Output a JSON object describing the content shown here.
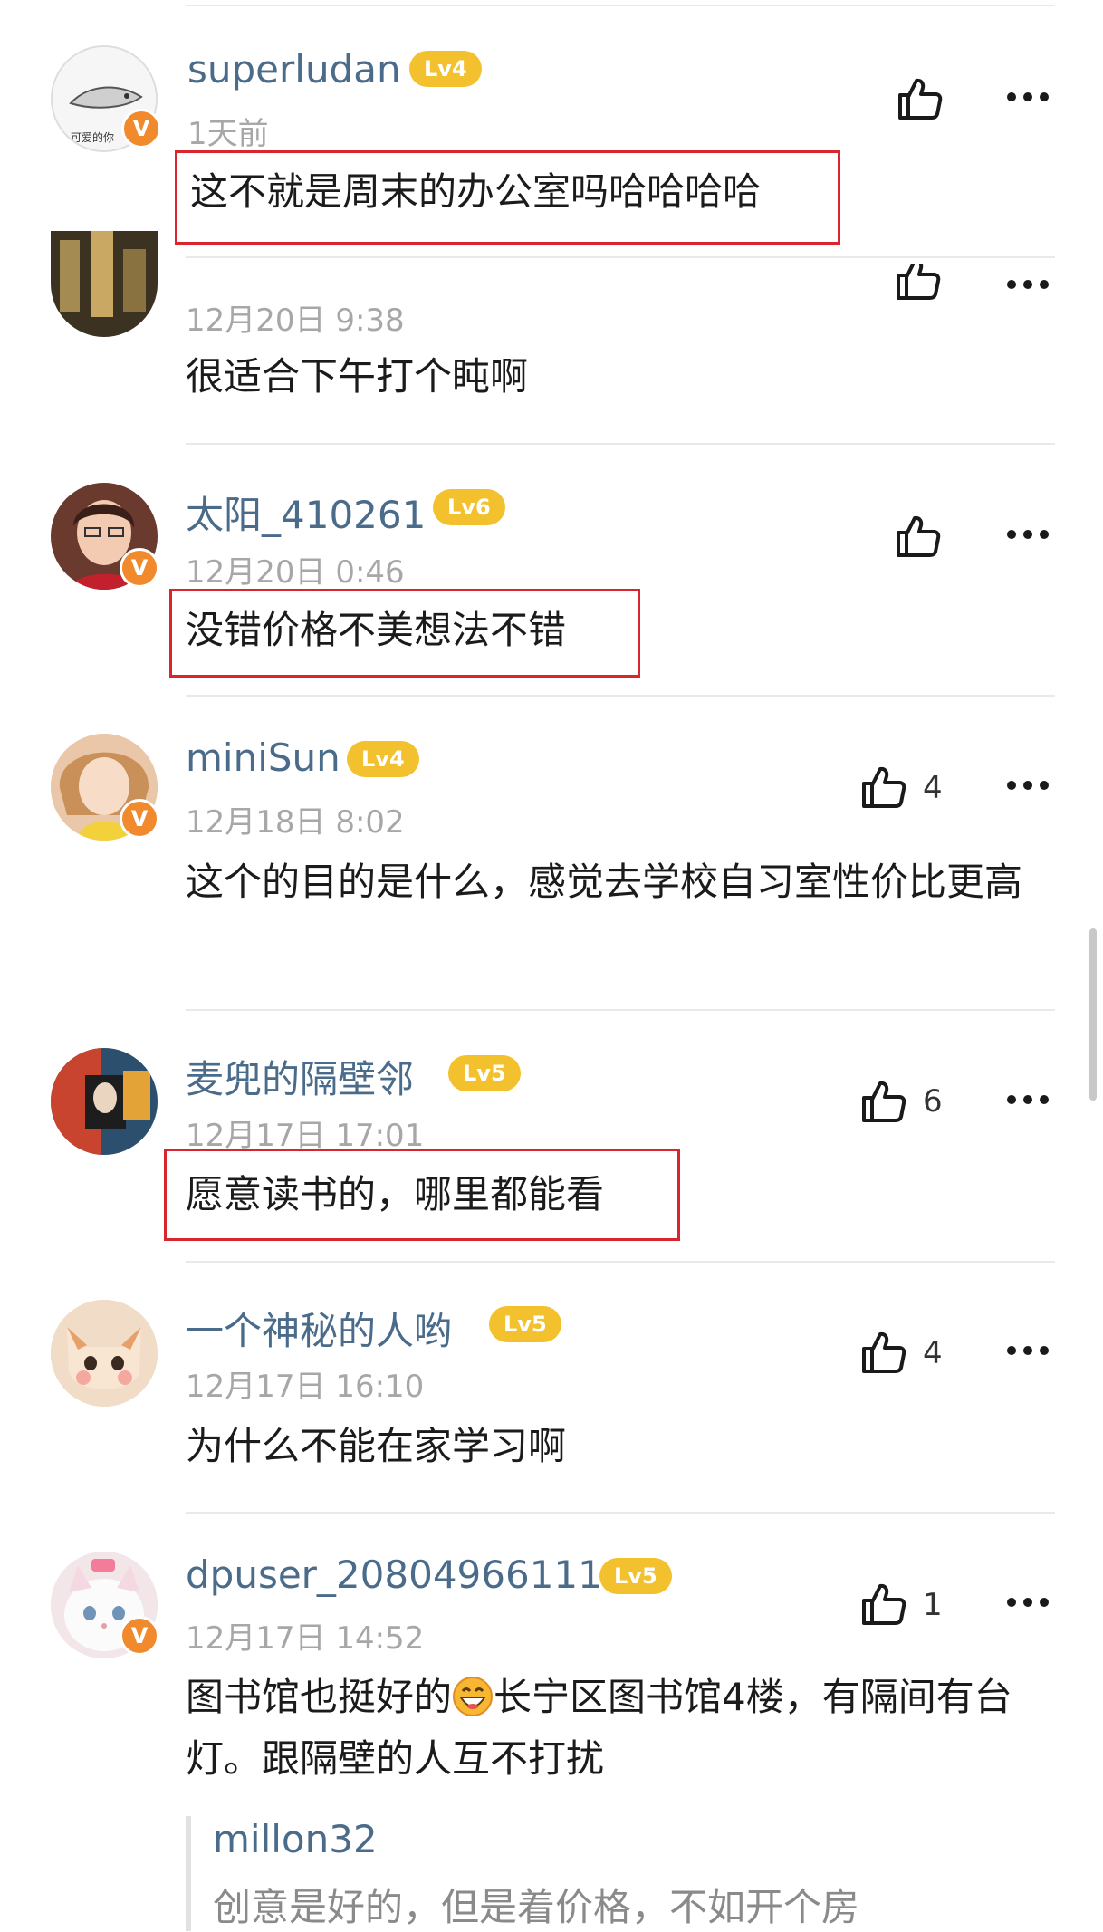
{
  "comments": [
    {
      "username": "superludan",
      "level": "Lv4",
      "time": "1天前",
      "text": "这不就是周末的办公室吗哈哈哈哈",
      "likes": ""
    },
    {
      "username": "",
      "level": "",
      "time": "12月20日  9:38",
      "text": "很适合下午打个盹啊",
      "likes": ""
    },
    {
      "username": "太阳_410261",
      "level": "Lv6",
      "time": "12月20日  0:46",
      "text": "没错价格不美想法不错",
      "likes": ""
    },
    {
      "username": "miniSun",
      "level": "Lv4",
      "time": "12月18日  8:02",
      "text": "这个的目的是什么，感觉去学校自习室性价比更高",
      "likes": "4"
    },
    {
      "username": "麦兜的隔壁邻",
      "level": "Lv5",
      "time": "12月17日  17:01",
      "text": "愿意读书的，哪里都能看",
      "likes": "6"
    },
    {
      "username": "一个神秘的人哟",
      "level": "Lv5",
      "time": "12月17日  16:10",
      "text": "为什么不能在家学习啊",
      "likes": "4"
    },
    {
      "username": "dpuser_20804966111",
      "level": "Lv5",
      "time": "12月17日  14:52",
      "text_before": "图书馆也挺好的",
      "text_after": "长宁区图书馆4楼，有隔间有台灯。跟隔壁的人互不打扰",
      "likes": "1"
    }
  ],
  "reply": {
    "username": "millon32",
    "text": "创意是好的，但是着价格，不如开个房"
  },
  "avatar_caption": "可爱的你",
  "verified_mark": "V",
  "colors": {
    "username": "#4a6b8a",
    "level_badge": "#f3c12e",
    "verified": "#f08a2c",
    "highlight_box": "#d9252e"
  }
}
